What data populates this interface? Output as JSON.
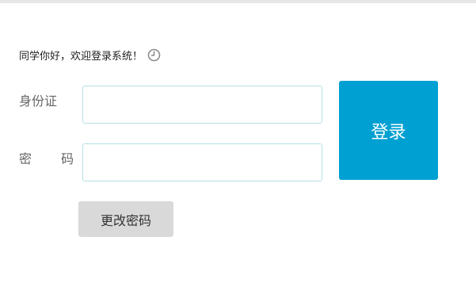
{
  "greeting": {
    "text": "同学你好，欢迎登录系统！",
    "icon": "clock-icon"
  },
  "form": {
    "id_label": "身份证",
    "id_value": "",
    "id_placeholder": "",
    "password_label": "密 码",
    "password_value": "",
    "password_placeholder": ""
  },
  "buttons": {
    "login_label": "登录",
    "change_password_label": "更改密码"
  },
  "colors": {
    "accent": "#00a0d2",
    "secondary_button": "#d9d9d9",
    "input_border": "#b5e0e6",
    "top_bar": "#e6e6e6"
  }
}
